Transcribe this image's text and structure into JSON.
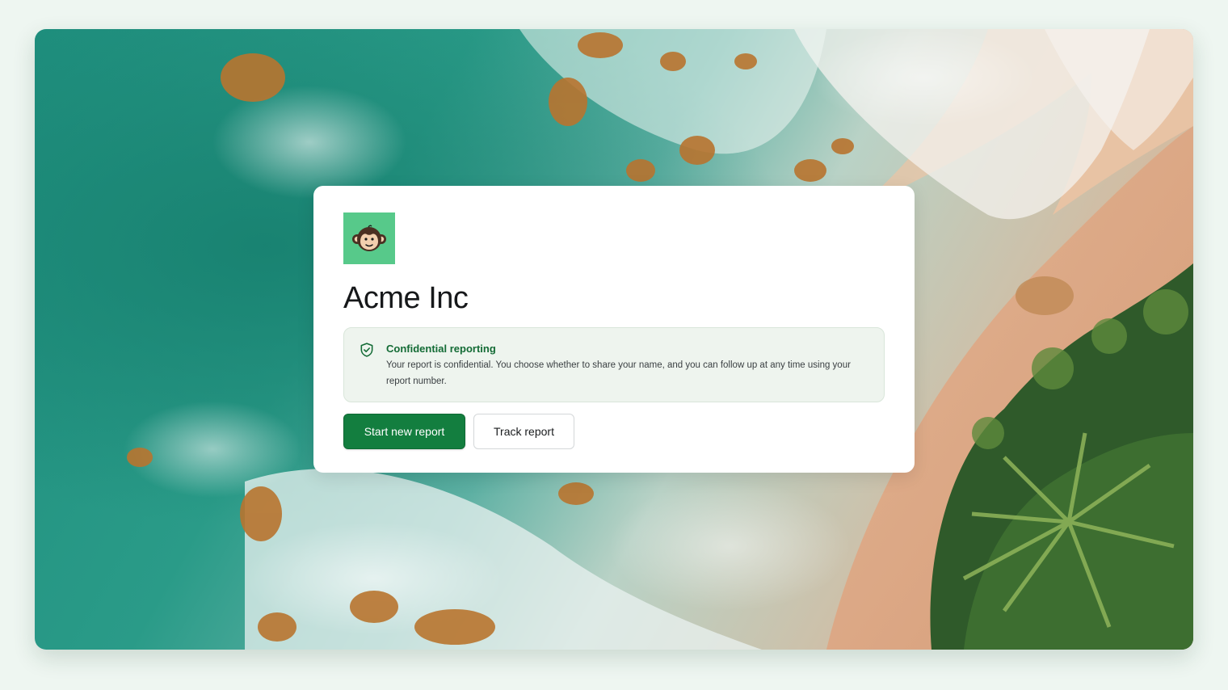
{
  "background": {
    "scene": "aerial-beach-coastline"
  },
  "brand": {
    "logo_icon": "monkey-face-icon",
    "logo_color": "#57c98a",
    "name": "Acme Inc"
  },
  "notice": {
    "icon": "shield-check-icon",
    "title": "Confidential reporting",
    "body": "Your report is confidential. You choose whether to share your name, and you can follow up at any time using your report number."
  },
  "actions": {
    "primary_label": "Start new report",
    "secondary_label": "Track report"
  },
  "colors": {
    "accent": "#137e3f",
    "notice_title": "#136b35",
    "notice_background": "#eef4ee"
  }
}
